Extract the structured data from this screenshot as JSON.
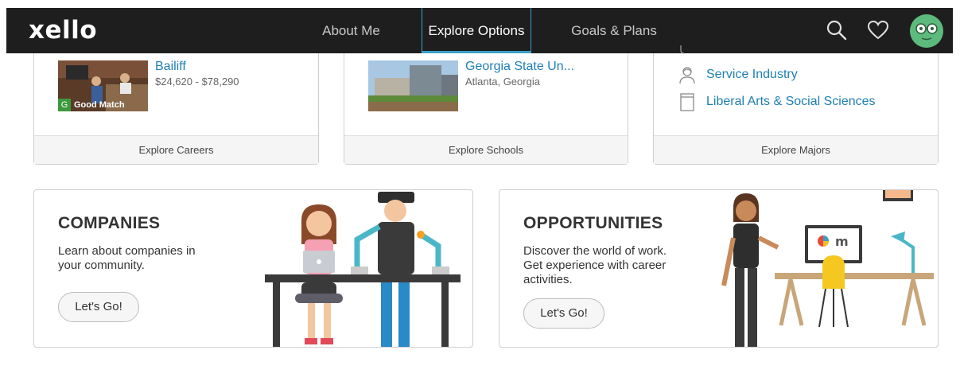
{
  "nav": {
    "logo": "xello",
    "tabs": [
      {
        "label": "About Me"
      },
      {
        "label": "Explore Options"
      },
      {
        "label": "Goals & Plans"
      }
    ]
  },
  "cards": {
    "careers": {
      "item_title": "Bailiff",
      "item_sub": "$24,620 - $78,290",
      "badge_letter": "G",
      "badge_label": "Good Match",
      "footer": "Explore Careers"
    },
    "schools": {
      "item_title": "Georgia State Un...",
      "item_sub": "Atlanta, Georgia",
      "footer": "Explore Schools"
    },
    "majors": {
      "items": [
        {
          "label": "Service Industry",
          "icon": "person-icon"
        },
        {
          "label": "Liberal Arts & Social Sciences",
          "icon": "book-icon"
        }
      ],
      "footer": "Explore Majors"
    }
  },
  "companies": {
    "title": "COMPANIES",
    "description_line1": "Learn about companies in",
    "description_line2": "your community.",
    "button": "Let's Go!"
  },
  "opportunities": {
    "title": "OPPORTUNITIES",
    "description_line1": "Discover the world of work.",
    "description_line2": "Get experience with career",
    "description_line3": "activities.",
    "button": "Let's Go!"
  },
  "colors": {
    "nav_bg": "#1e1e1e",
    "accent": "#3aa0c8",
    "link": "#1f7fb3"
  }
}
